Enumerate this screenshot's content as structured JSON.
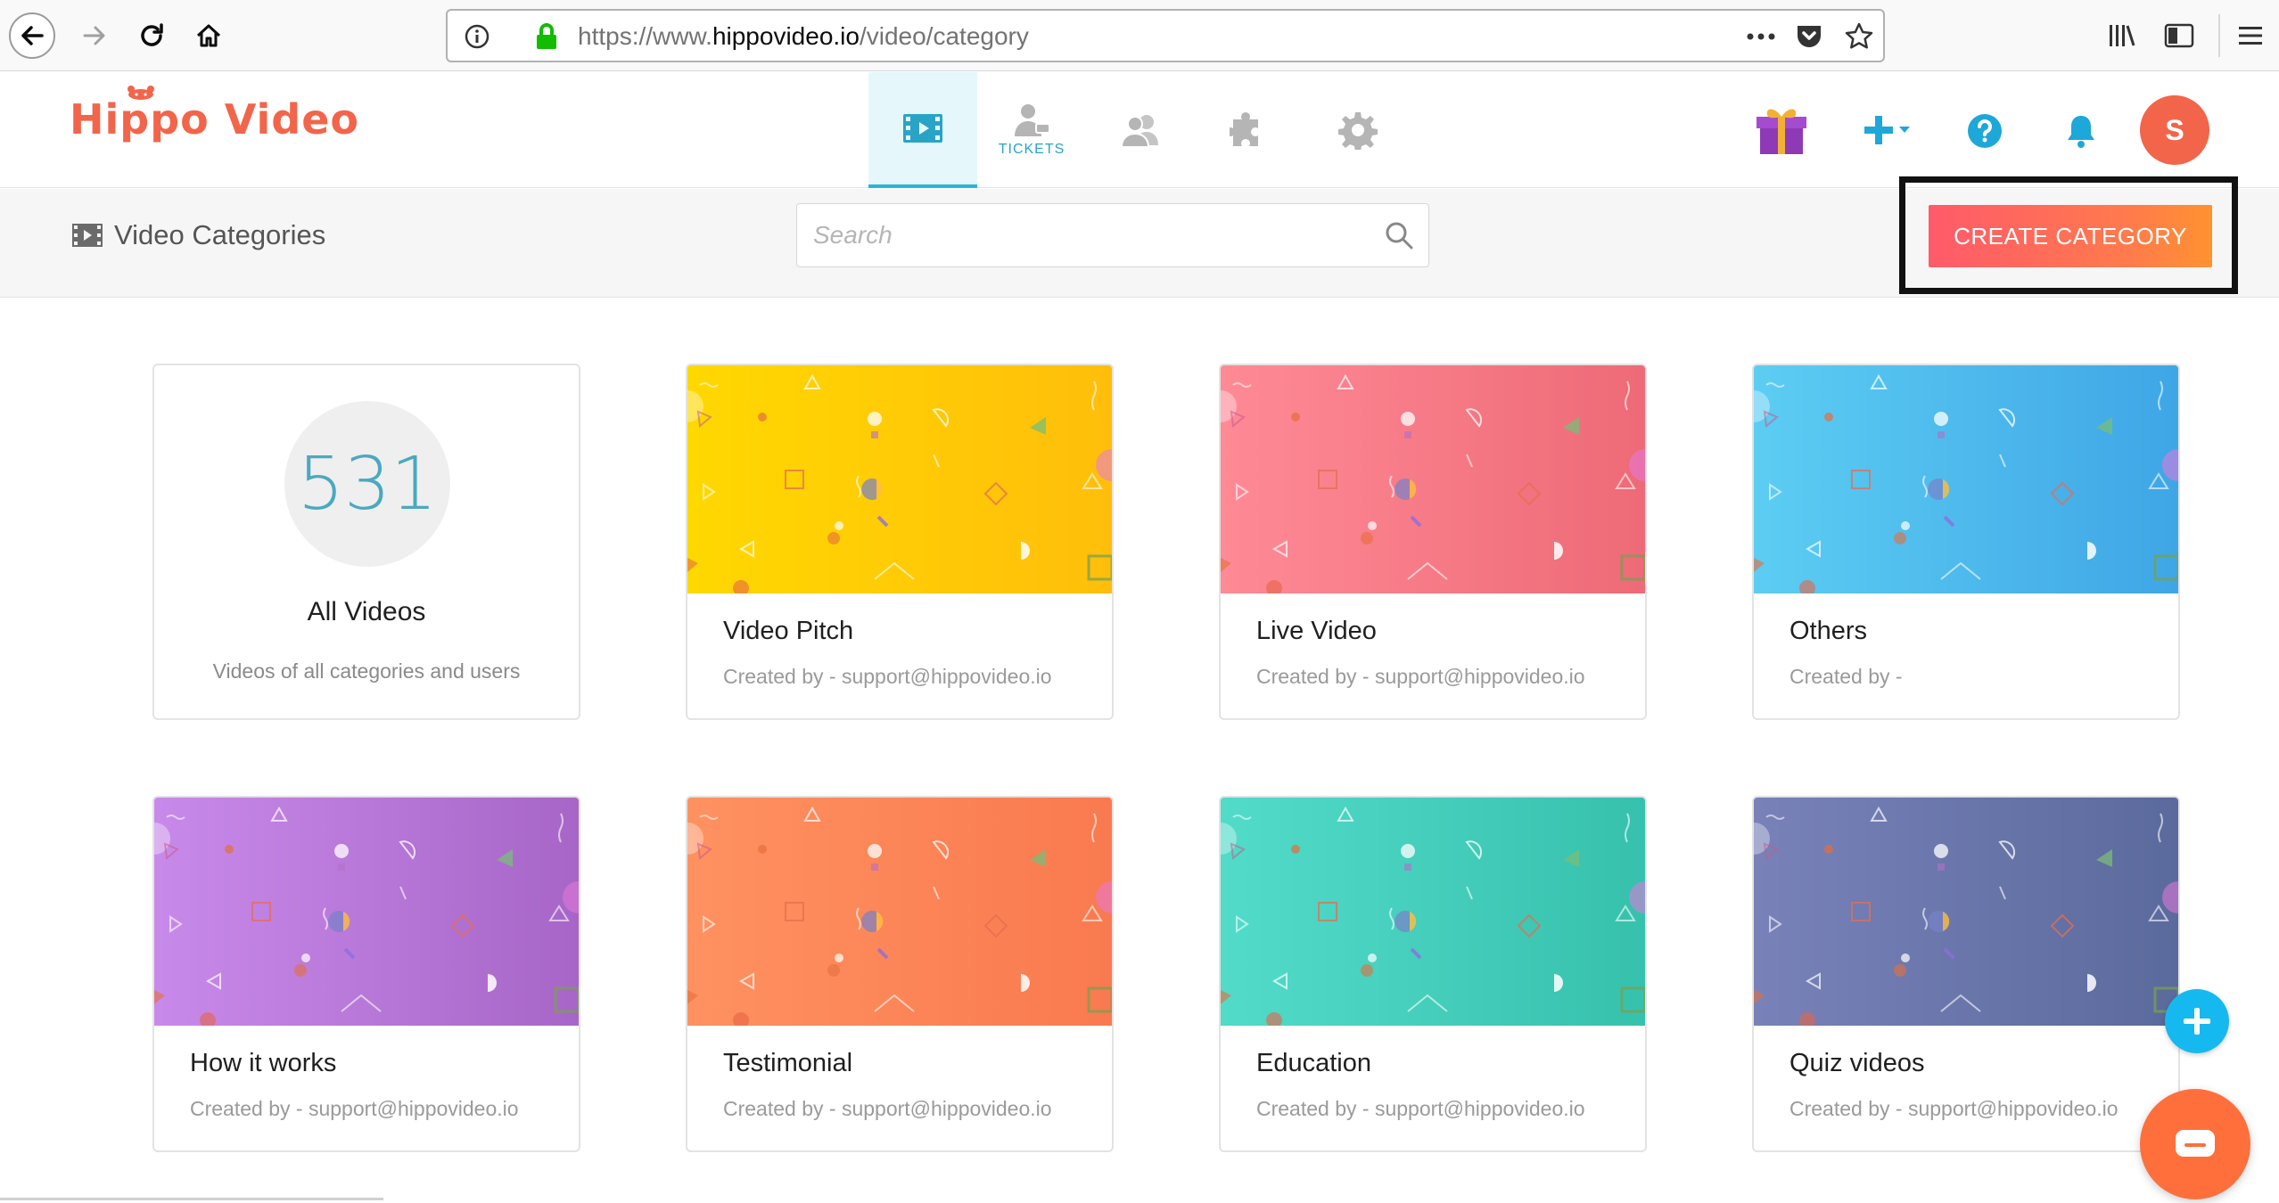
{
  "browser": {
    "url_prefix": "https://www.",
    "url_host": "hippovideo.io",
    "url_path": "/video/category"
  },
  "header": {
    "logo": "Hippo Video",
    "tabs": [
      {
        "icon": "video-icon",
        "label": "",
        "active": true
      },
      {
        "icon": "tickets-icon",
        "label": "TICKETS",
        "active": false
      },
      {
        "icon": "users-icon",
        "label": "",
        "active": false
      },
      {
        "icon": "puzzle-icon",
        "label": "",
        "active": false
      },
      {
        "icon": "gear-icon",
        "label": "",
        "active": false
      }
    ],
    "avatar_letter": "S"
  },
  "subheader": {
    "title": "Video Categories",
    "search_placeholder": "Search",
    "create_label": "CREATE CATEGORY"
  },
  "all_videos": {
    "count": "531",
    "title": "All Videos",
    "subtitle": "Videos of all categories and users"
  },
  "categories": [
    {
      "title": "Video Pitch",
      "created_by": "Created by - support@hippovideo.io",
      "color_start": "#ffd800",
      "color_end": "#ffbe0b"
    },
    {
      "title": "Live Video",
      "created_by": "Created by - support@hippovideo.io",
      "color_start": "#fe8a96",
      "color_end": "#ee6a77"
    },
    {
      "title": "Others",
      "created_by": "Created by -",
      "color_start": "#5ccdf3",
      "color_end": "#3fa6e6"
    },
    {
      "title": "How it works",
      "created_by": "Created by - support@hippovideo.io",
      "color_start": "#c88aea",
      "color_end": "#a766c7"
    },
    {
      "title": "Testimonial",
      "created_by": "Created by - support@hippovideo.io",
      "color_start": "#ff9160",
      "color_end": "#f97a4f"
    },
    {
      "title": "Education",
      "created_by": "Created by - support@hippovideo.io",
      "color_start": "#52dbc9",
      "color_end": "#36c1ad"
    },
    {
      "title": "Quiz videos",
      "created_by": "Created by - support@hippovideo.io",
      "color_start": "#7882b9",
      "color_end": "#5b6a9c"
    }
  ],
  "colors": {
    "brand": "#f2654a",
    "accent": "#29b5d6",
    "fab": "#16b9ef",
    "chat": "#ff6f3c"
  }
}
